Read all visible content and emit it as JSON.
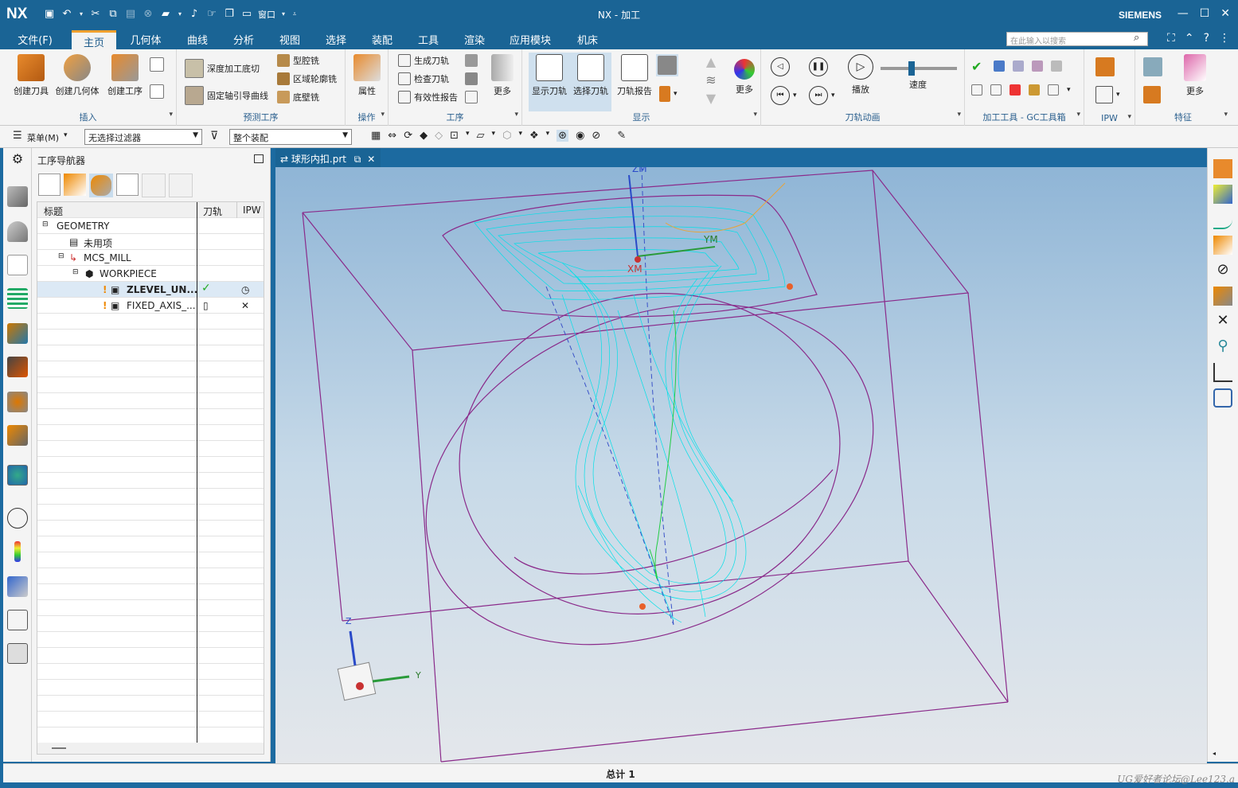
{
  "titlebar": {
    "logo": "NX",
    "window_menu": "窗口",
    "title": "NX - 加工",
    "brand": "SIEMENS"
  },
  "menu": {
    "tabs": [
      "文件(F)",
      "主页",
      "几何体",
      "曲线",
      "分析",
      "视图",
      "选择",
      "装配",
      "工具",
      "渲染",
      "应用模块",
      "机床"
    ],
    "active": "主页",
    "search_placeholder": "在此输入以搜索"
  },
  "ribbon": {
    "insert": {
      "label": "插入",
      "buttons": [
        "创建刀具",
        "创建几何体",
        "创建工序"
      ]
    },
    "predict": {
      "label": "预测工序",
      "items": [
        "深度加工底切",
        "固定轴引导曲线",
        "型腔铣",
        "区域轮廓铣",
        "底壁铣"
      ]
    },
    "operation": {
      "label": "操作",
      "buttons": [
        "属性"
      ]
    },
    "procedure": {
      "label": "工序",
      "items": [
        "生成刀轨",
        "检查刀轨",
        "有效性报告"
      ],
      "more": "更多"
    },
    "display": {
      "label": "显示",
      "buttons": [
        "显示刀轨",
        "选择刀轨",
        "刀轨报告"
      ],
      "more": "更多"
    },
    "animation": {
      "label": "刀轨动画",
      "play": "播放",
      "speed": "速度",
      "speed_level": 0.4
    },
    "gc": {
      "label": "加工工具 - GC工具箱"
    },
    "ipw": {
      "label": "IPW"
    },
    "feature": {
      "label": "特征",
      "more": "更多"
    }
  },
  "subbar": {
    "menu": "菜单(M)",
    "filter": "无选择过滤器",
    "assembly": "整个装配"
  },
  "navigator": {
    "title": "工序导航器",
    "columns": [
      "标题",
      "刀轨",
      "IPW"
    ],
    "rows": [
      {
        "name": "GEOMETRY",
        "toolpath": "",
        "ipw": ""
      },
      {
        "name": "未用项",
        "toolpath": "",
        "ipw": ""
      },
      {
        "name": "MCS_MILL",
        "toolpath": "",
        "ipw": ""
      },
      {
        "name": "WORKPIECE",
        "toolpath": "",
        "ipw": ""
      },
      {
        "name": "ZLEVEL_UN...",
        "toolpath": "✓",
        "ipw": "◷"
      },
      {
        "name": "FIXED_AXIS_...",
        "toolpath": "▯",
        "ipw": "✕"
      }
    ]
  },
  "doc_tab": {
    "label": "球形内扣.prt"
  },
  "viewport": {
    "axis_labels": {
      "zm": "ZM",
      "ym": "YM",
      "xm": "XM",
      "z": "Z",
      "y": "Y"
    }
  },
  "status": {
    "text": "总计 1",
    "watermark": "UG爱好者论坛@Lee123.a"
  },
  "colors": {
    "frame": "#1a6495",
    "accent": "#f0a02e",
    "toolpath": "#00e0e8",
    "wire": "#8a2a8a"
  }
}
